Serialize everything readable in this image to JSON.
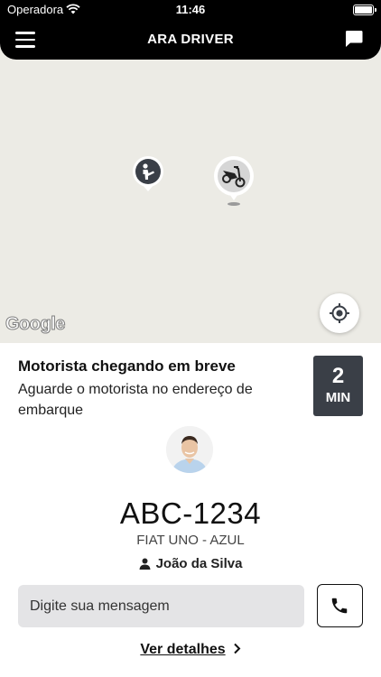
{
  "status_bar": {
    "carrier": "Operadora",
    "time": "11:46"
  },
  "header": {
    "title": "ARA DRIVER",
    "icons": [
      "menu-icon",
      "chat-icon"
    ]
  },
  "map": {
    "attribution": "Google",
    "markers": [
      "passenger-pin-icon",
      "motorcycle-pin-icon"
    ]
  },
  "ride": {
    "heading": "Motorista chegando em breve",
    "subtitle": "Aguarde o motorista no endereço de embarque",
    "eta_value": "2",
    "eta_unit": "MIN",
    "plate": "ABC-1234",
    "car": "FIAT UNO - AZUL",
    "driver_name": "João da Silva",
    "message_placeholder": "Digite sua mensagem",
    "details_label": "Ver detalhes"
  },
  "colors": {
    "header_bg": "#000000",
    "map_bg": "#ecebe5",
    "eta_bg": "#3a3f47",
    "input_bg": "#e4e4e6"
  }
}
